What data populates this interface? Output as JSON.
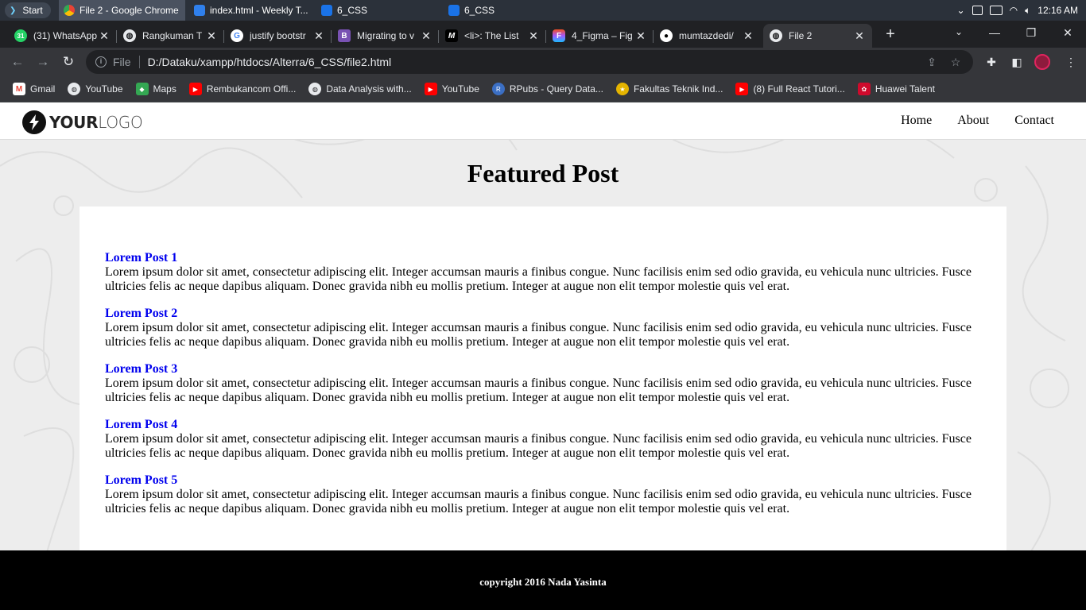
{
  "taskbar": {
    "start_label": "Start",
    "items": [
      {
        "label": "File 2 - Google Chrome",
        "color": "#4285f4"
      },
      {
        "label": "index.html - Weekly T...",
        "color": "#2f80ed"
      },
      {
        "label": "6_CSS",
        "color": "#1a73e8"
      },
      {
        "label": "6_CSS",
        "color": "#1a73e8"
      }
    ],
    "time": "12:16 AM"
  },
  "tabs": [
    {
      "title": "(31) WhatsApp",
      "icon": "whatsapp-icon",
      "color": "#25d366",
      "glyph": "31"
    },
    {
      "title": "Rangkuman T",
      "icon": "globe-icon",
      "color": "#5f6368",
      "glyph": "◍"
    },
    {
      "title": "justify bootstr",
      "icon": "google-icon",
      "color": "#ffffff",
      "glyph": "G"
    },
    {
      "title": "Migrating to v",
      "icon": "bootstrap-icon",
      "color": "#7952b3",
      "glyph": "B"
    },
    {
      "title": "<li>: The List",
      "icon": "mdn-icon",
      "color": "#000000",
      "glyph": "M"
    },
    {
      "title": "4_Figma – Fig",
      "icon": "figma-icon",
      "color": "#f24e1e",
      "glyph": "F"
    },
    {
      "title": "mumtazdedi/",
      "icon": "github-icon",
      "color": "#000000",
      "glyph": "●"
    },
    {
      "title": "File 2",
      "icon": "globe-icon",
      "color": "#5f6368",
      "glyph": "◍"
    }
  ],
  "address_bar": {
    "scheme": "File",
    "url": "D:/Dataku/xampp/htdocs/Alterra/6_CSS/file2.html"
  },
  "bookmarks": [
    {
      "label": "Gmail",
      "icon": "gmail-icon",
      "color": "#ea4335",
      "glyph": "M"
    },
    {
      "label": "YouTube",
      "icon": "globe-icon",
      "color": "#5f6368",
      "glyph": "◍"
    },
    {
      "label": "Maps",
      "icon": "maps-icon",
      "color": "#34a853",
      "glyph": "◆"
    },
    {
      "label": "Rembukancom Offi...",
      "icon": "youtube-icon",
      "color": "#ff0000",
      "glyph": "▶"
    },
    {
      "label": "Data Analysis with...",
      "icon": "globe-icon",
      "color": "#5f6368",
      "glyph": "◍"
    },
    {
      "label": "YouTube",
      "icon": "youtube-icon",
      "color": "#ff0000",
      "glyph": "▶"
    },
    {
      "label": "RPubs - Query Data...",
      "icon": "rpubs-icon",
      "color": "#3b6fc4",
      "glyph": "R"
    },
    {
      "label": "Fakultas Teknik Ind...",
      "icon": "university-icon",
      "color": "#e5b400",
      "glyph": "★"
    },
    {
      "label": "(8) Full React Tutori...",
      "icon": "youtube-icon",
      "color": "#ff0000",
      "glyph": "▶"
    },
    {
      "label": "Huawei Talent",
      "icon": "huawei-icon",
      "color": "#cf0a2c",
      "glyph": "✿"
    }
  ],
  "site": {
    "logo": {
      "bold": "YOUR",
      "light": "LOGO"
    },
    "nav": [
      "Home",
      "About",
      "Contact"
    ],
    "heading": "Featured Post",
    "posts": [
      {
        "title": "Lorem Post 1",
        "body": "Lorem ipsum dolor sit amet, consectetur adipiscing elit. Integer accumsan mauris a finibus congue. Nunc facilisis enim sed odio gravida, eu vehicula nunc ultricies. Fusce ultricies felis ac neque dapibus aliquam. Donec gravida nibh eu mollis pretium. Integer at augue non elit tempor molestie quis vel erat."
      },
      {
        "title": "Lorem Post 2",
        "body": "Lorem ipsum dolor sit amet, consectetur adipiscing elit. Integer accumsan mauris a finibus congue. Nunc facilisis enim sed odio gravida, eu vehicula nunc ultricies. Fusce ultricies felis ac neque dapibus aliquam. Donec gravida nibh eu mollis pretium. Integer at augue non elit tempor molestie quis vel erat."
      },
      {
        "title": "Lorem Post 3",
        "body": "Lorem ipsum dolor sit amet, consectetur adipiscing elit. Integer accumsan mauris a finibus congue. Nunc facilisis enim sed odio gravida, eu vehicula nunc ultricies. Fusce ultricies felis ac neque dapibus aliquam. Donec gravida nibh eu mollis pretium. Integer at augue non elit tempor molestie quis vel erat."
      },
      {
        "title": "Lorem Post 4",
        "body": "Lorem ipsum dolor sit amet, consectetur adipiscing elit. Integer accumsan mauris a finibus congue. Nunc facilisis enim sed odio gravida, eu vehicula nunc ultricies. Fusce ultricies felis ac neque dapibus aliquam. Donec gravida nibh eu mollis pretium. Integer at augue non elit tempor molestie quis vel erat."
      },
      {
        "title": "Lorem Post 5",
        "body": "Lorem ipsum dolor sit amet, consectetur adipiscing elit. Integer accumsan mauris a finibus congue. Nunc facilisis enim sed odio gravida, eu vehicula nunc ultricies. Fusce ultricies felis ac neque dapibus aliquam. Donec gravida nibh eu mollis pretium. Integer at augue non elit tempor molestie quis vel erat."
      }
    ],
    "footer": "copyright 2016 Nada Yasinta"
  }
}
